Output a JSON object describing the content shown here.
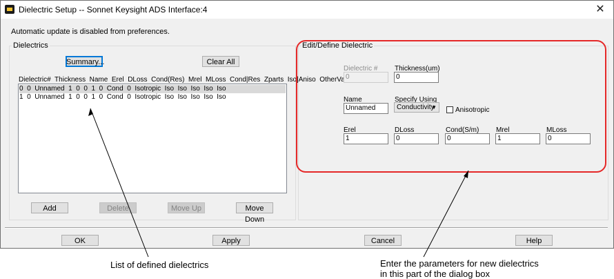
{
  "window": {
    "title": "Dielectric Setup -- Sonnet Keysight ADS Interface:4",
    "close_symbol": "✕",
    "info_text": "Automatic update is disabled from preferences."
  },
  "dielectrics_group": {
    "title": "Dielectrics",
    "summary_label": "Summary...",
    "clear_all_label": "Clear All",
    "header": "Dielectric#  Thickness  Name  Erel  DLoss  Cond(Res)  Mrel  MLoss  Cond|Res  Zparts  Iso|Aniso  OtherValues",
    "rows": [
      "0  0  Unnamed  1  0  0  1  0  Cond  0  Isotropic  Iso  Iso  Iso  Iso  Iso",
      "1  0  Unnamed  1  0  0  1  0  Cond  0  Isotropic  Iso  Iso  Iso  Iso  Iso"
    ],
    "add_label": "Add",
    "delete_label": "Delete",
    "move_up_label": "Move Up",
    "move_down_label": "Move Down"
  },
  "edit_group": {
    "title": "Edit/Define Dielectric",
    "dielectric_num_label": "Dielectric #",
    "dielectric_num_value": "0",
    "thickness_label": "Thickness(um)",
    "thickness_value": "0",
    "name_label": "Name",
    "name_value": "Unnamed",
    "specify_label": "Specify Using",
    "specify_value": "Conductivity",
    "anisotropic_label": "Anisotropic",
    "anisotropic_checked": false,
    "erel_label": "Erel",
    "erel_value": "1",
    "dloss_label": "DLoss",
    "dloss_value": "0",
    "cond_label": "Cond(S/m)",
    "cond_value": "0",
    "mrel_label": "Mrel",
    "mrel_value": "1",
    "mloss_label": "MLoss",
    "mloss_value": "0"
  },
  "footer": {
    "ok_label": "OK",
    "apply_label": "Apply",
    "cancel_label": "Cancel",
    "help_label": "Help"
  },
  "annotations": {
    "left_callout": "List of defined dielectrics",
    "right_callout_line1": "Enter the parameters for new dielectrics",
    "right_callout_line2": "in this part of the dialog box"
  },
  "colors": {
    "highlight_frame": "#e52727",
    "selected_row": "#d9d9d9",
    "dialog_background": "#f0f0f0"
  }
}
